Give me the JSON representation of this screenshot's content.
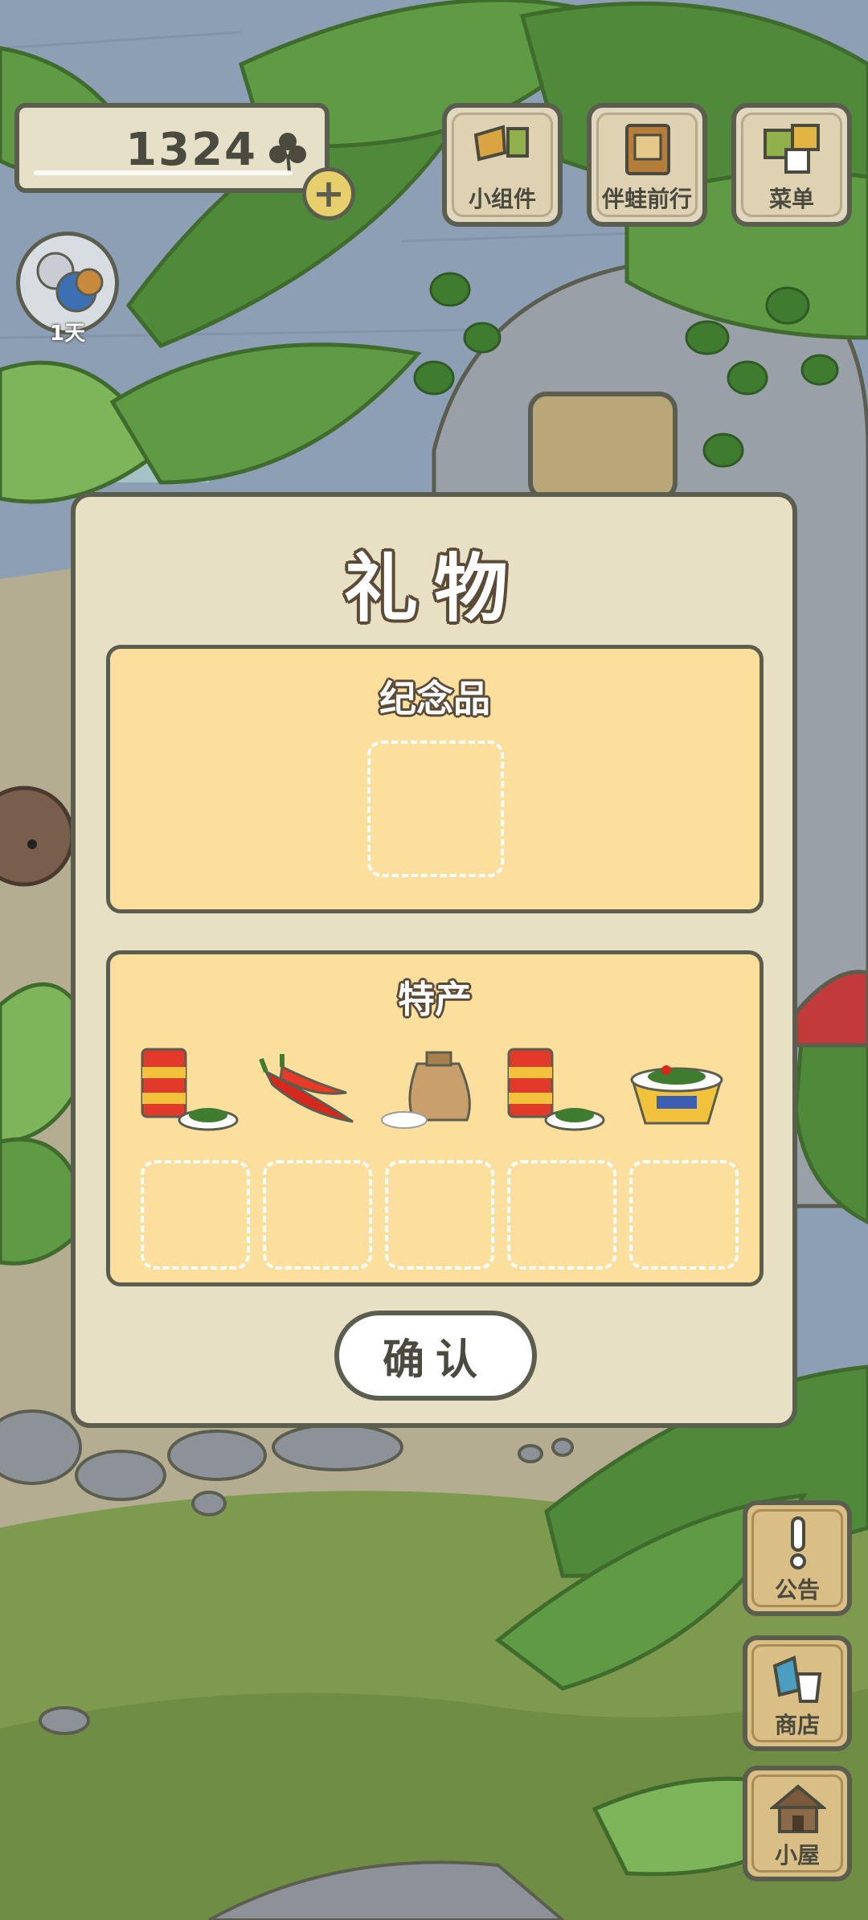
{
  "hud": {
    "clover_count": "1324",
    "plus": "+"
  },
  "top_buttons": [
    {
      "label": "小组件"
    },
    {
      "label": "伴蛙前行"
    },
    {
      "label": "菜单"
    }
  ],
  "avatar": {
    "day": "1天"
  },
  "modal": {
    "title": "礼物",
    "souvenir": {
      "title": "纪念品"
    },
    "specialty": {
      "title": "特产",
      "items": [
        "canned-food-with-vegetables",
        "red-chili-peppers",
        "rice-sack",
        "canned-food-with-vegetables",
        "noodle-bowl"
      ]
    },
    "confirm": "确认"
  },
  "side_buttons": [
    {
      "label": "公告"
    },
    {
      "label": "商店"
    },
    {
      "label": "小屋"
    }
  ],
  "colors": {
    "outline": "#5b5e4e",
    "panel": "#fddf9d",
    "modal": "#e8e0c4",
    "leaf_dark": "#4f8a3a",
    "leaf_light": "#7fb55a"
  }
}
